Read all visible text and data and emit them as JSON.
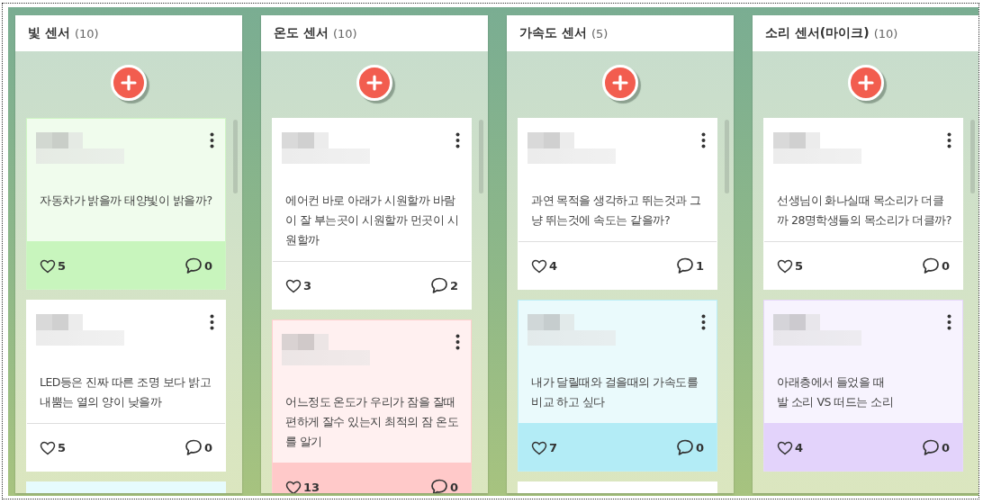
{
  "columns": [
    {
      "title": "빛 센서",
      "count": "(10)",
      "cards": [
        {
          "color": "#c8f5bd",
          "text": "자동차가 밝을까 태양빛이 밝을까?",
          "likes": "5",
          "comments": "0"
        },
        {
          "color": "#ffffff",
          "text": "LED등은 진짜 따른 조명 보다 밝고 내뿜는 열의 양이 낮을까",
          "likes": "5",
          "comments": "0"
        },
        {
          "color": "#e6fbfd"
        }
      ]
    },
    {
      "title": "온도 센서",
      "count": "(10)",
      "cards": [
        {
          "color": "#ffffff",
          "text": "에어컨 바로 아래가 시원할까 바람이 잘 부는곳이 시원할까 먼곳이 시원할까",
          "likes": "3",
          "comments": "2"
        },
        {
          "color": "#ffc9c9",
          "text": "어느정도 온도가 우리가 잠을 잘때 편하게 잘수 있는지 최적의 잠 온도를 알기",
          "likes": "13",
          "comments": "0"
        }
      ]
    },
    {
      "title": "가속도 센서",
      "count": "(5)",
      "cards": [
        {
          "color": "#ffffff",
          "text": "과연 목적을 생각하고 뛰는것과 그냥 뛰는것에 속도는 같을까?",
          "likes": "4",
          "comments": "1"
        },
        {
          "color": "#b3ecf6",
          "text": "내가 달릴때와 걸을때의 가속도를 비교 하고 싶다",
          "likes": "7",
          "comments": "0"
        },
        {
          "color": "#ffffff"
        }
      ]
    },
    {
      "title": "소리 센서(마이크)",
      "count": "(10)",
      "cards": [
        {
          "color": "#ffffff",
          "text": "선생님이 화나실때 목소리가 더클까 28명학생들의 목소리가 더클까?",
          "likes": "5",
          "comments": "0"
        },
        {
          "color": "#e3d3fb",
          "text": "아래층에서 들었을 때\n발 소리 VS 떠드는 소리",
          "likes": "4",
          "comments": "0"
        }
      ]
    }
  ]
}
